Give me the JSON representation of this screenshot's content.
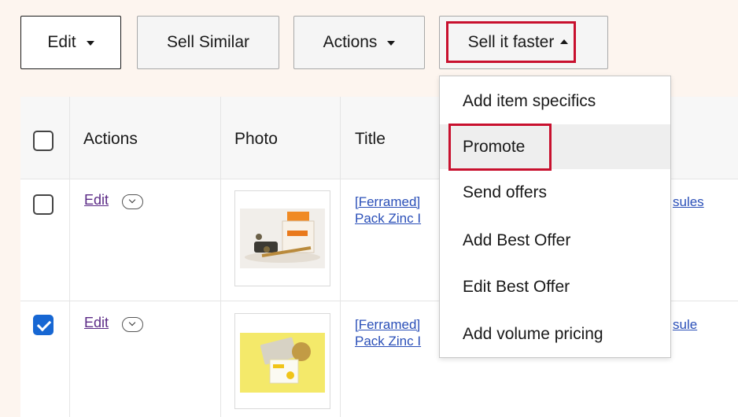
{
  "toolbar": {
    "edit_label": "Edit",
    "sell_similar_label": "Sell Similar",
    "actions_label": "Actions",
    "sell_it_faster_label": "Sell it faster"
  },
  "table": {
    "headers": {
      "actions": "Actions",
      "photo": "Photo",
      "title": "Title"
    },
    "rows": [
      {
        "checked": false,
        "edit_label": "Edit",
        "title_line1": "[Ferramed]",
        "title_line2": "Pack Zinc I",
        "title_tail": "sules"
      },
      {
        "checked": true,
        "edit_label": "Edit",
        "title_line1": "[Ferramed]",
        "title_line2": "Pack Zinc I",
        "title_tail": "sule"
      }
    ]
  },
  "menu": {
    "items": [
      "Add item specifics",
      "Promote",
      "Send offers",
      "Add Best Offer",
      "Edit Best Offer",
      "Add volume pricing"
    ]
  },
  "colors": {
    "highlight": "#c8102e",
    "link": "#2a4fb8",
    "visited_link": "#5b2a86",
    "checkbox_checked": "#1767d3",
    "background": "#fdf5ef"
  }
}
